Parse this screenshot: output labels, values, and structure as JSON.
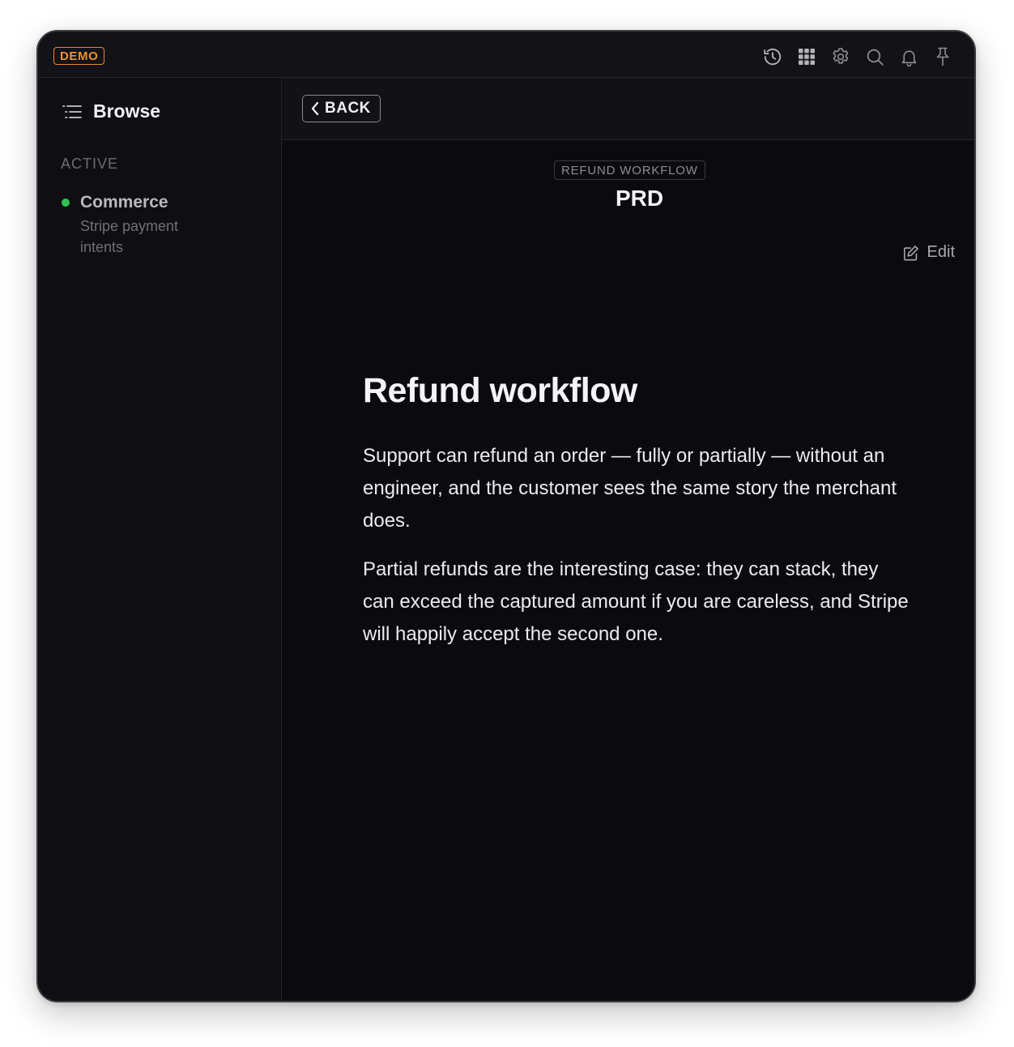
{
  "topbar": {
    "badge": "DEMO",
    "icons": [
      "history-icon",
      "apps-grid-icon",
      "gear-icon",
      "search-icon",
      "bell-icon",
      "pin-icon"
    ]
  },
  "sidebar": {
    "browse_label": "Browse",
    "section_label": "ACTIVE",
    "items": [
      {
        "title": "Commerce",
        "subtitle": "Stripe payment intents",
        "status_color": "#2fc24f"
      }
    ]
  },
  "main": {
    "back_label": "BACK",
    "doc_kind": "REFUND WORKFLOW",
    "doc_title": "PRD",
    "edit_label": "Edit",
    "article": {
      "heading": "Refund workflow",
      "paragraphs": [
        "Support can refund an order — fully or partially — without an engineer, and the customer sees the same story the merchant does.",
        "Partial refunds are the interesting case: they can stack, they can exceed the captured amount if you are careless, and Stripe will happily accept the second one."
      ]
    }
  },
  "colors": {
    "accent": "#f0922f",
    "status_active": "#2fc24f",
    "background": "#0b0b0f"
  }
}
